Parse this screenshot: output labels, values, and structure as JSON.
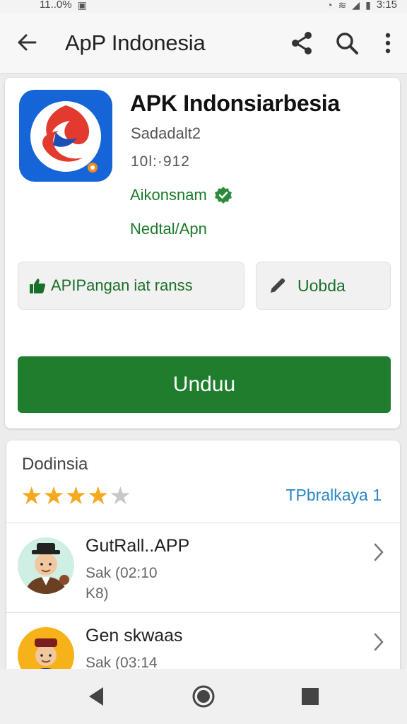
{
  "status_bar": {
    "time_left": "11..0%",
    "time_right": "3:15"
  },
  "app_bar": {
    "title": "ApP Indonesia",
    "back_icon": "arrow-left-icon",
    "share_icon": "share-icon",
    "search_icon": "search-icon",
    "more_icon": "more-vert-icon"
  },
  "app": {
    "name": "APK Indonsiarbesia",
    "developer": "Sadadalt2",
    "version": "10l:·912",
    "publisher": "Aikonsnam",
    "category": "Nedtal/Apn",
    "permissions_label": "APIPangan iat ranss",
    "update_label": "Uobda",
    "download_label": "Unduu"
  },
  "reviews": {
    "title": "Dodinsia",
    "rating": 4,
    "max_rating": 5,
    "see_all": "TPbralkaya 1",
    "items": [
      {
        "name": "GutRall..APP",
        "meta_line1": "Sak (02:10",
        "meta_line2": "K8)"
      },
      {
        "name": "Gen skwaas",
        "meta_line1": "Sak (03:14",
        "meta_line2": ""
      }
    ]
  },
  "colors": {
    "accent_green": "#1e7e2d",
    "text_green": "#1a7a2a",
    "link_blue": "#2b86c5",
    "star_gold": "#f4a91f",
    "star_grey": "#c8c8c8",
    "app_icon_blue": "#1565d8"
  }
}
